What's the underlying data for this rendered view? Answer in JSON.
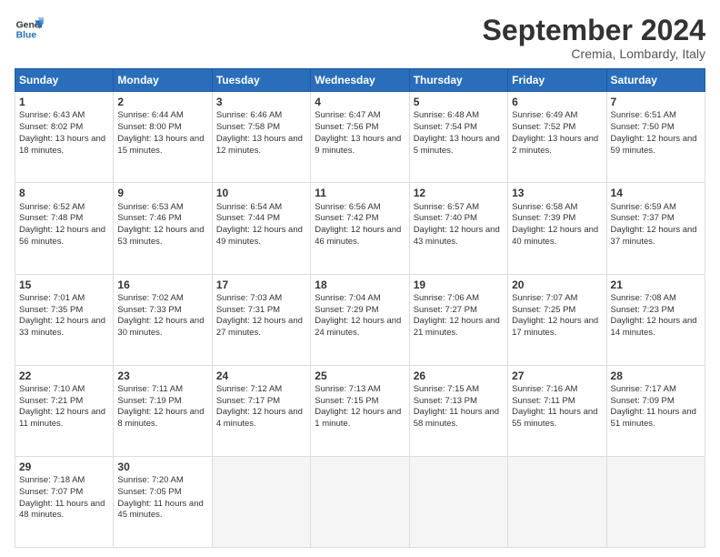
{
  "logo": {
    "line1": "General",
    "line2": "Blue"
  },
  "title": "September 2024",
  "subtitle": "Cremia, Lombardy, Italy",
  "weekdays": [
    "Sunday",
    "Monday",
    "Tuesday",
    "Wednesday",
    "Thursday",
    "Friday",
    "Saturday"
  ],
  "weeks": [
    [
      {
        "day": 1,
        "sunrise": "6:43 AM",
        "sunset": "8:02 PM",
        "daylight": "13 hours and 18 minutes."
      },
      {
        "day": 2,
        "sunrise": "6:44 AM",
        "sunset": "8:00 PM",
        "daylight": "13 hours and 15 minutes."
      },
      {
        "day": 3,
        "sunrise": "6:46 AM",
        "sunset": "7:58 PM",
        "daylight": "13 hours and 12 minutes."
      },
      {
        "day": 4,
        "sunrise": "6:47 AM",
        "sunset": "7:56 PM",
        "daylight": "13 hours and 9 minutes."
      },
      {
        "day": 5,
        "sunrise": "6:48 AM",
        "sunset": "7:54 PM",
        "daylight": "13 hours and 5 minutes."
      },
      {
        "day": 6,
        "sunrise": "6:49 AM",
        "sunset": "7:52 PM",
        "daylight": "13 hours and 2 minutes."
      },
      {
        "day": 7,
        "sunrise": "6:51 AM",
        "sunset": "7:50 PM",
        "daylight": "12 hours and 59 minutes."
      }
    ],
    [
      {
        "day": 8,
        "sunrise": "6:52 AM",
        "sunset": "7:48 PM",
        "daylight": "12 hours and 56 minutes."
      },
      {
        "day": 9,
        "sunrise": "6:53 AM",
        "sunset": "7:46 PM",
        "daylight": "12 hours and 53 minutes."
      },
      {
        "day": 10,
        "sunrise": "6:54 AM",
        "sunset": "7:44 PM",
        "daylight": "12 hours and 49 minutes."
      },
      {
        "day": 11,
        "sunrise": "6:56 AM",
        "sunset": "7:42 PM",
        "daylight": "12 hours and 46 minutes."
      },
      {
        "day": 12,
        "sunrise": "6:57 AM",
        "sunset": "7:40 PM",
        "daylight": "12 hours and 43 minutes."
      },
      {
        "day": 13,
        "sunrise": "6:58 AM",
        "sunset": "7:39 PM",
        "daylight": "12 hours and 40 minutes."
      },
      {
        "day": 14,
        "sunrise": "6:59 AM",
        "sunset": "7:37 PM",
        "daylight": "12 hours and 37 minutes."
      }
    ],
    [
      {
        "day": 15,
        "sunrise": "7:01 AM",
        "sunset": "7:35 PM",
        "daylight": "12 hours and 33 minutes."
      },
      {
        "day": 16,
        "sunrise": "7:02 AM",
        "sunset": "7:33 PM",
        "daylight": "12 hours and 30 minutes."
      },
      {
        "day": 17,
        "sunrise": "7:03 AM",
        "sunset": "7:31 PM",
        "daylight": "12 hours and 27 minutes."
      },
      {
        "day": 18,
        "sunrise": "7:04 AM",
        "sunset": "7:29 PM",
        "daylight": "12 hours and 24 minutes."
      },
      {
        "day": 19,
        "sunrise": "7:06 AM",
        "sunset": "7:27 PM",
        "daylight": "12 hours and 21 minutes."
      },
      {
        "day": 20,
        "sunrise": "7:07 AM",
        "sunset": "7:25 PM",
        "daylight": "12 hours and 17 minutes."
      },
      {
        "day": 21,
        "sunrise": "7:08 AM",
        "sunset": "7:23 PM",
        "daylight": "12 hours and 14 minutes."
      }
    ],
    [
      {
        "day": 22,
        "sunrise": "7:10 AM",
        "sunset": "7:21 PM",
        "daylight": "12 hours and 11 minutes."
      },
      {
        "day": 23,
        "sunrise": "7:11 AM",
        "sunset": "7:19 PM",
        "daylight": "12 hours and 8 minutes."
      },
      {
        "day": 24,
        "sunrise": "7:12 AM",
        "sunset": "7:17 PM",
        "daylight": "12 hours and 4 minutes."
      },
      {
        "day": 25,
        "sunrise": "7:13 AM",
        "sunset": "7:15 PM",
        "daylight": "12 hours and 1 minute."
      },
      {
        "day": 26,
        "sunrise": "7:15 AM",
        "sunset": "7:13 PM",
        "daylight": "11 hours and 58 minutes."
      },
      {
        "day": 27,
        "sunrise": "7:16 AM",
        "sunset": "7:11 PM",
        "daylight": "11 hours and 55 minutes."
      },
      {
        "day": 28,
        "sunrise": "7:17 AM",
        "sunset": "7:09 PM",
        "daylight": "11 hours and 51 minutes."
      }
    ],
    [
      {
        "day": 29,
        "sunrise": "7:18 AM",
        "sunset": "7:07 PM",
        "daylight": "11 hours and 48 minutes."
      },
      {
        "day": 30,
        "sunrise": "7:20 AM",
        "sunset": "7:05 PM",
        "daylight": "11 hours and 45 minutes."
      },
      null,
      null,
      null,
      null,
      null
    ]
  ]
}
